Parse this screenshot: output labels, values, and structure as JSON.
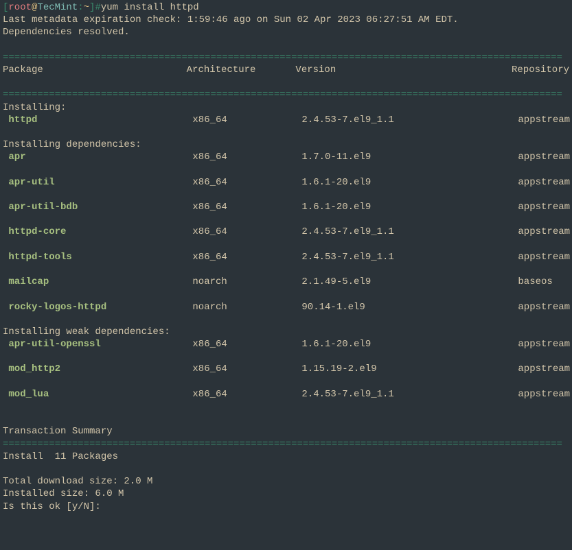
{
  "prompt": {
    "user": "root",
    "host": "TecMint",
    "path": "~",
    "command": "yum install httpd"
  },
  "output": {
    "metadata": "Last metadata expiration check: 1:59:46 ago on Sun 02 Apr 2023 06:27:51 AM EDT.",
    "deps_resolved": "Dependencies resolved.",
    "divider": "=================================================================================================",
    "transaction_summary": "Transaction Summary",
    "install_count": "Install  11 Packages",
    "download_size": "Total download size: 2.0 M",
    "installed_size": "Installed size: 6.0 M",
    "confirm": "Is this ok [y/N]: "
  },
  "headers": [
    "Package",
    "Architecture",
    "Version",
    "Repository"
  ],
  "sections": {
    "installing": "Installing:",
    "installing_deps": "Installing dependencies:",
    "installing_weak": "Installing weak dependencies:"
  },
  "packages": [
    {
      "name": "httpd",
      "arch": "x86_64",
      "version": "2.4.53-7.el9_1.1",
      "repo": "appstream"
    },
    {
      "name": "apr",
      "arch": "x86_64",
      "version": "1.7.0-11.el9",
      "repo": "appstream"
    },
    {
      "name": "apr-util",
      "arch": "x86_64",
      "version": "1.6.1-20.el9",
      "repo": "appstream"
    },
    {
      "name": "apr-util-bdb",
      "arch": "x86_64",
      "version": "1.6.1-20.el9",
      "repo": "appstream"
    },
    {
      "name": "httpd-core",
      "arch": "x86_64",
      "version": "2.4.53-7.el9_1.1",
      "repo": "appstream"
    },
    {
      "name": "httpd-tools",
      "arch": "x86_64",
      "version": "2.4.53-7.el9_1.1",
      "repo": "appstream"
    },
    {
      "name": "mailcap",
      "arch": "noarch",
      "version": "2.1.49-5.el9",
      "repo": "baseos"
    },
    {
      "name": "rocky-logos-httpd",
      "arch": "noarch",
      "version": "90.14-1.el9",
      "repo": "appstream"
    },
    {
      "name": "apr-util-openssl",
      "arch": "x86_64",
      "version": "1.6.1-20.el9",
      "repo": "appstream"
    },
    {
      "name": "mod_http2",
      "arch": "x86_64",
      "version": "1.15.19-2.el9",
      "repo": "appstream"
    },
    {
      "name": "mod_lua",
      "arch": "x86_64",
      "version": "2.4.53-7.el9_1.1",
      "repo": "appstream"
    }
  ]
}
